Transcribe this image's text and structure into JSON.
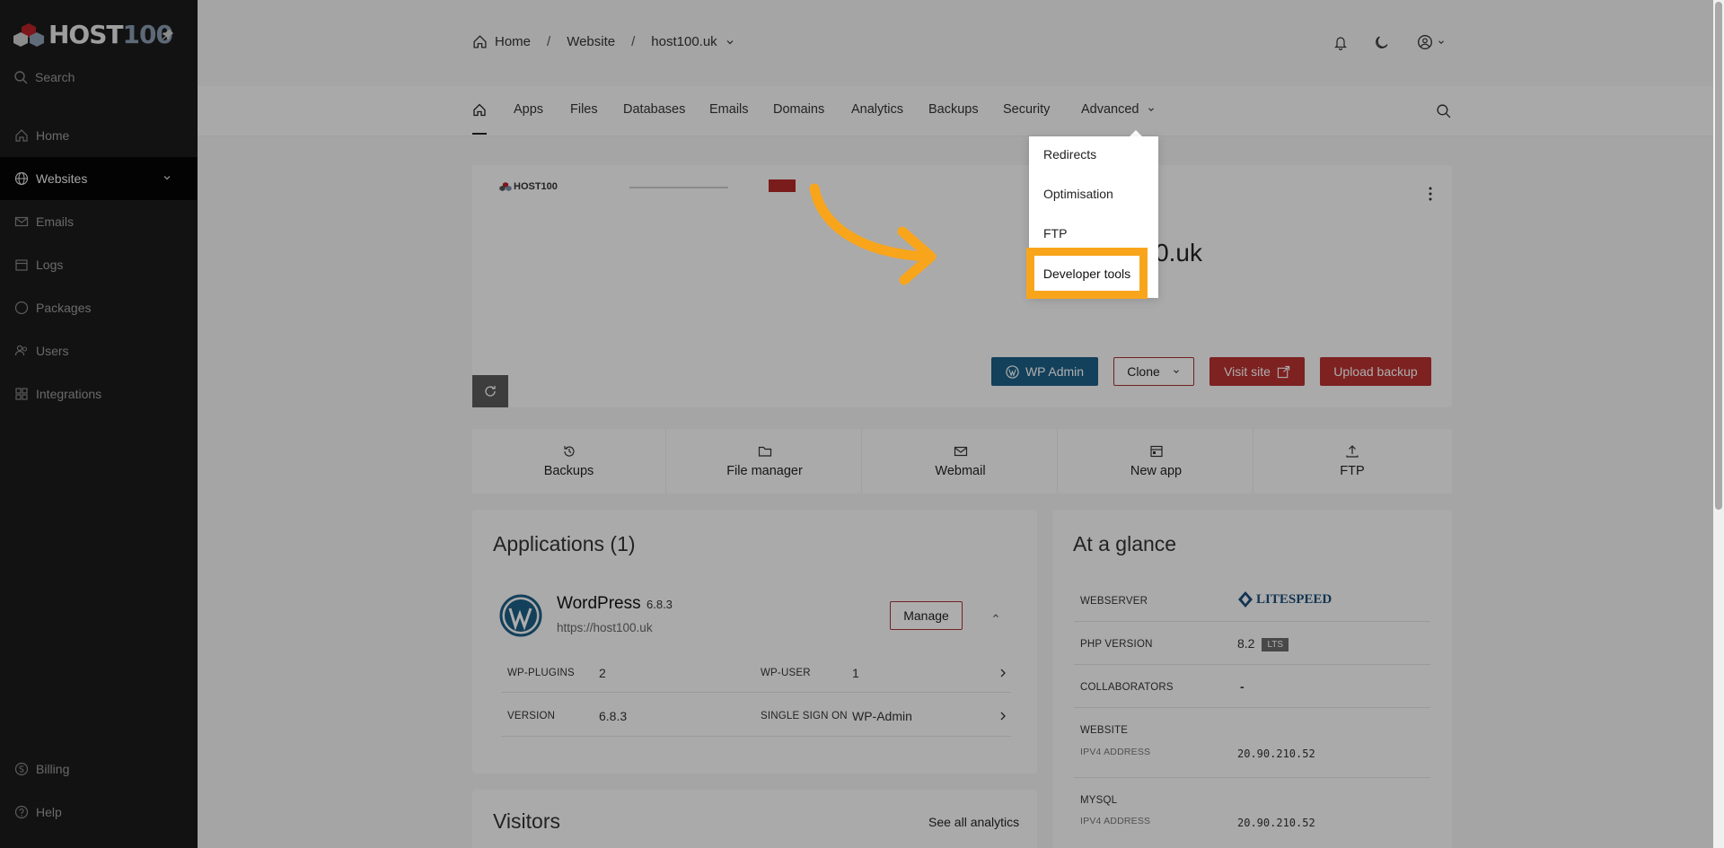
{
  "sidebar": {
    "logo": {
      "text": "HOST",
      "num": "100"
    },
    "search_label": "Search",
    "items": [
      {
        "label": "Home",
        "icon": "home-icon"
      },
      {
        "label": "Websites",
        "icon": "globe-icon",
        "active": true
      },
      {
        "label": "Emails",
        "icon": "mail-icon"
      },
      {
        "label": "Logs",
        "icon": "calendar-icon"
      },
      {
        "label": "Packages",
        "icon": "circle-icon"
      },
      {
        "label": "Users",
        "icon": "users-icon"
      },
      {
        "label": "Integrations",
        "icon": "grid-icon"
      }
    ],
    "bottom": [
      {
        "label": "Billing",
        "icon": "billing-icon"
      },
      {
        "label": "Help",
        "icon": "help-icon"
      }
    ]
  },
  "breadcrumb": {
    "home": "Home",
    "section": "Website",
    "current": "host100.uk"
  },
  "tabs": [
    "Apps",
    "Files",
    "Databases",
    "Emails",
    "Domains",
    "Analytics",
    "Backups",
    "Security",
    "Advanced"
  ],
  "advanced_menu": [
    "Redirects",
    "Optimisation",
    "FTP",
    "Developer tools"
  ],
  "site": {
    "domain": "host100.uk",
    "buttons": {
      "wp_admin": "WP Admin",
      "clone": "Clone",
      "visit": "Visit site",
      "upload": "Upload backup"
    }
  },
  "quick_actions": [
    "Backups",
    "File manager",
    "Webmail",
    "New app",
    "FTP"
  ],
  "applications": {
    "title": "Applications (1)",
    "app_name": "WordPress",
    "app_version": "6.8.3",
    "app_url": "https://host100.uk",
    "manage": "Manage",
    "rows": {
      "plugins_label": "WP-PLUGINS",
      "plugins_value": "2",
      "user_label": "WP-USER",
      "user_value": "1",
      "version_label": "VERSION",
      "version_value": "6.8.3",
      "sso_label": "SINGLE SIGN ON",
      "sso_value": "WP-Admin"
    }
  },
  "glance": {
    "title": "At a glance",
    "webserver_label": "WEBSERVER",
    "webserver_value": "LITESPEED",
    "php_label": "PHP VERSION",
    "php_value": "8.2",
    "php_badge": "LTS",
    "collab_label": "COLLABORATORS",
    "collab_value": "-",
    "website_label": "WEBSITE",
    "website_ip_label": "IPV4 ADDRESS",
    "website_ip": "20.90.210.52",
    "mysql_label": "MYSQL",
    "mysql_ip_label": "IPV4 ADDRESS",
    "mysql_ip": "20.90.210.52"
  },
  "visitors": {
    "title": "Visitors",
    "link": "See all analytics"
  },
  "colors": {
    "wp_blue": "#1d5f86",
    "red": "#a83232",
    "highlight": "#f9a51b",
    "sidebar": "#1b1b1b"
  }
}
